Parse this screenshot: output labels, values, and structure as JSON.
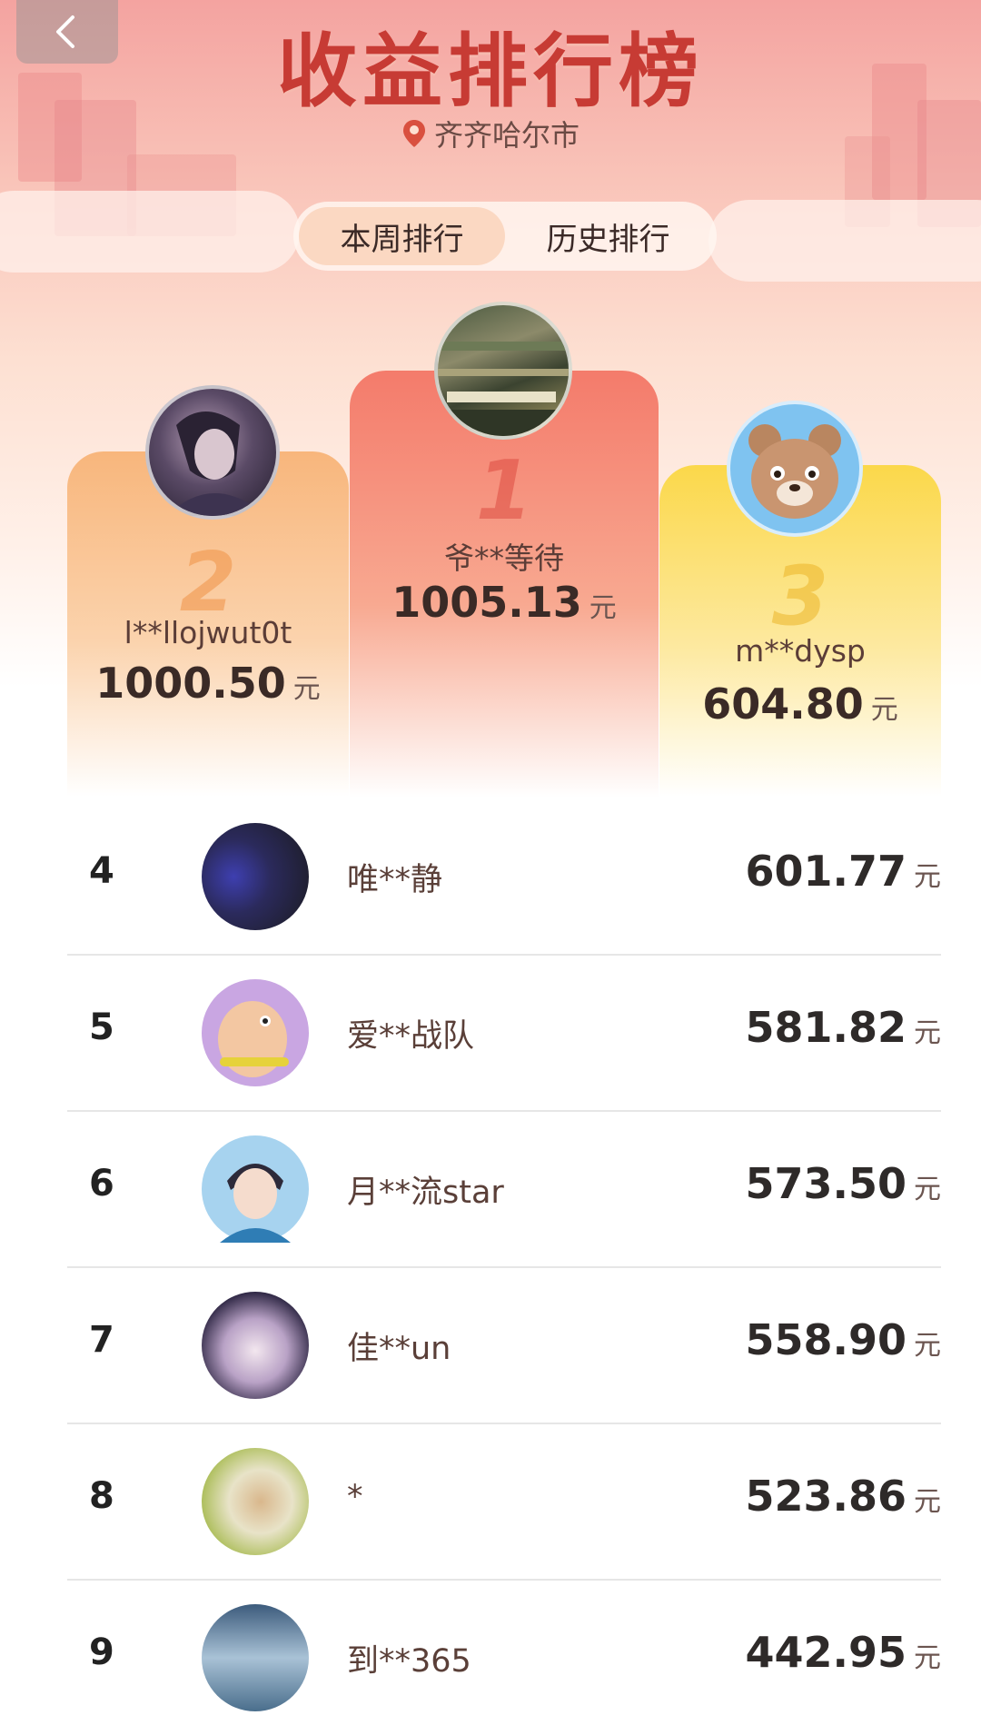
{
  "header": {
    "title": "收益排行榜",
    "location": "齐齐哈尔市",
    "back_icon": "chevron-left-icon",
    "location_icon": "map-pin-icon"
  },
  "tabs": [
    {
      "label": "本周排行",
      "active": true
    },
    {
      "label": "历史排行",
      "active": false
    }
  ],
  "podium": {
    "first": {
      "rank": "1",
      "name": "爷**等待",
      "amount": "1005.13",
      "unit": "元"
    },
    "second": {
      "rank": "2",
      "name": "l**llojwut0t",
      "amount": "1000.50",
      "unit": "元"
    },
    "third": {
      "rank": "3",
      "name": "m**dysp",
      "amount": "604.80",
      "unit": "元"
    }
  },
  "list": [
    {
      "rank": "4",
      "name": "唯**静",
      "amount": "601.77",
      "unit": "元"
    },
    {
      "rank": "5",
      "name": "爱**战队",
      "amount": "581.82",
      "unit": "元"
    },
    {
      "rank": "6",
      "name": "月**流star",
      "amount": "573.50",
      "unit": "元"
    },
    {
      "rank": "7",
      "name": "佳**un",
      "amount": "558.90",
      "unit": "元"
    },
    {
      "rank": "8",
      "name": "*",
      "amount": "523.86",
      "unit": "元"
    },
    {
      "rank": "9",
      "name": "到**365",
      "amount": "442.95",
      "unit": "元"
    }
  ],
  "colors": {
    "title": "#c73b34",
    "podium_first": "#f47b6b",
    "podium_second": "#f8b67c",
    "podium_third": "#fbd84a"
  }
}
